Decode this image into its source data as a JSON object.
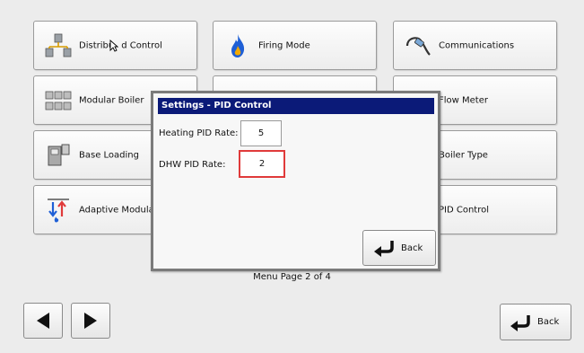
{
  "tiles": [
    {
      "label": "Distribu",
      "label_suffix": "d Control",
      "icon": "distributed-control-icon"
    },
    {
      "label": "Firing Mode",
      "icon": "flame-icon"
    },
    {
      "label": "Communications",
      "icon": "cable-icon"
    },
    {
      "label": "Modular Boiler",
      "icon": "modular-boiler-icon"
    },
    {
      "label": "Flow Meter",
      "icon": "flow-meter-icon"
    },
    {
      "label": "Base Loading",
      "icon": "base-loading-icon"
    },
    {
      "label": "Boiler Type",
      "icon": "boiler-type-icon"
    },
    {
      "label": "Adaptive Modula",
      "icon": "adaptive-modulation-icon"
    },
    {
      "label": "PID Control",
      "icon": "pid-control-icon"
    }
  ],
  "menu_page": "Menu Page 2 of 4",
  "nav": {
    "back_label": "Back"
  },
  "dialog": {
    "title": "Settings - PID Control",
    "heating_label": "Heating PID Rate:",
    "heating_value": "5",
    "dhw_label": "DHW PID Rate:",
    "dhw_value": "2",
    "back_label": "Back"
  },
  "colors": {
    "title_bar": "#0b1a78",
    "focus_border": "#e03a3a",
    "flame": "#1e5fd6"
  }
}
